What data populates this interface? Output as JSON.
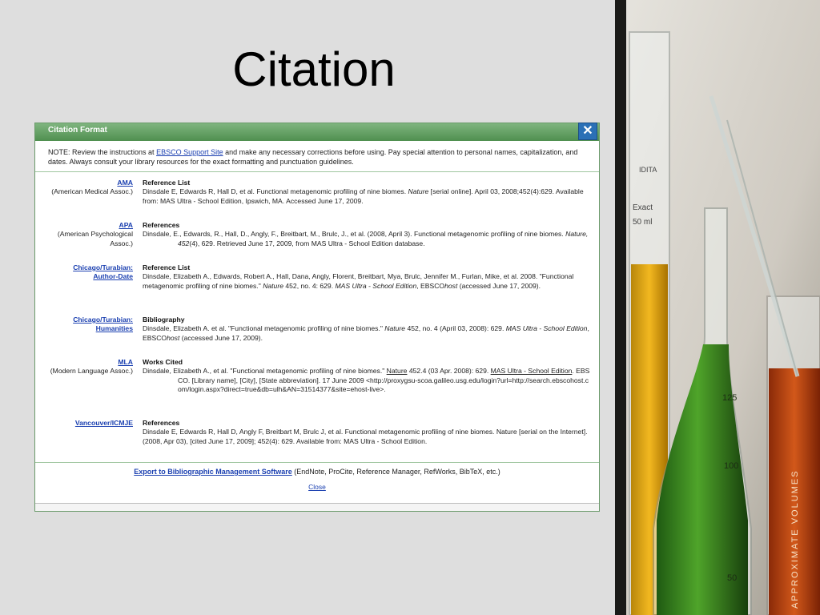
{
  "slide": {
    "title": "Citation"
  },
  "dialog": {
    "title": "Citation Format",
    "close_symbol": "✕",
    "note_pre": "NOTE: Review the instructions at ",
    "note_link": "EBSCO Support Site",
    "note_post": " and make any necessary corrections before using. Pay special attention to personal names, capitalization, and dates. Always consult your library resources for the exact formatting and punctuation guidelines.",
    "rows": [
      {
        "style": "AMA",
        "style_sub": "(American Medical Assoc.)",
        "heading": "Reference List",
        "citation_parts": [
          "Dinsdale E, Edwards R, Hall D, et al. Functional metagenomic profiling of nine biomes. ",
          "Nature",
          " [serial online]. April 03, 2008;452(4):629. Available from: MAS Ultra - School Edition, Ipswich, MA. Accessed June 17, 2009."
        ]
      },
      {
        "style": "APA",
        "style_sub": "(American Psychological Assoc.)",
        "heading": "References",
        "citation_parts": [
          "Dinsdale, E., Edwards, R., Hall, D., Angly, F., Breitbart, M., Brulc, J., et al. (2008, April 3). Functional metagenomic profiling of nine biomes. ",
          "Nature, 452",
          "(4), 629. Retrieved June 17, 2009, from MAS Ultra - School Edition database."
        ]
      },
      {
        "style": "Chicago/Turabian: Author-Date",
        "style_sub": "",
        "heading": "Reference List",
        "citation_parts": [
          "Dinsdale, Elizabeth A., Edwards, Robert A., Hall, Dana, Angly, Florent, Breitbart, Mya, Brulc, Jennifer M., Furlan, Mike, et al. 2008. \"Functional metagenomic profiling of nine biomes.\" ",
          "Nature",
          " 452, no. 4: 629. ",
          "MAS Ultra - School Edition",
          ", EBSCO",
          "host",
          " (accessed June 17, 2009)."
        ]
      },
      {
        "style": "Chicago/Turabian: Humanities",
        "style_sub": "",
        "heading": "Bibliography",
        "citation_parts": [
          "Dinsdale, Elizabeth A. et al. \"Functional metagenomic profiling of nine biomes.\" ",
          "Nature",
          " 452, no. 4 (April 03, 2008): 629. ",
          "MAS Ultra - School Edition",
          ", EBSCO",
          "host",
          " (accessed June 17, 2009)."
        ]
      },
      {
        "style": "MLA",
        "style_sub": "(Modern Language Assoc.)",
        "heading": "Works Cited",
        "citation_parts": [
          "Dinsdale, Elizabeth A., et al. \"Functional metagenomic profiling of nine biomes.\" ",
          "Nature",
          " 452.4 (03 Apr. 2008): 629. ",
          "MAS Ultra - School Edition",
          ". EBSCO. [Library name], [City], [State abbreviation]. 17 June 2009 <http://proxygsu-scoa.galileo.usg.edu/login?url=http://search.ebscohost.com/login.aspx?direct=true&db=ulh&AN=31514377&site=ehost-live>."
        ]
      },
      {
        "style": "Vancouver/ICMJE",
        "style_sub": "",
        "heading": "References",
        "citation_parts": [
          "Dinsdale E, Edwards R, Hall D, Angly F, Breitbart M, Brulc J, et al. Functional metagenomic profiling of nine biomes. Nature [serial on the Internet]. (2008, Apr 03), [cited June 17, 2009]; 452(4): 629. Available from: MAS Ultra - School Edition."
        ]
      }
    ],
    "export_link": "Export to Bibliographic Management Software",
    "export_post": " (EndNote, ProCite, Reference Manager, RefWorks, BibTeX, etc.)",
    "close_label": "Close"
  },
  "photo": {
    "tube_label_1": "IDITA",
    "tube_label_2": "Exact",
    "tube_label_3": "50 ml",
    "beaker_mark_1": "125",
    "beaker_mark_2": "100",
    "beaker_mark_3": "50",
    "beaker_text": "APPROXIMATE VOLUMES"
  }
}
